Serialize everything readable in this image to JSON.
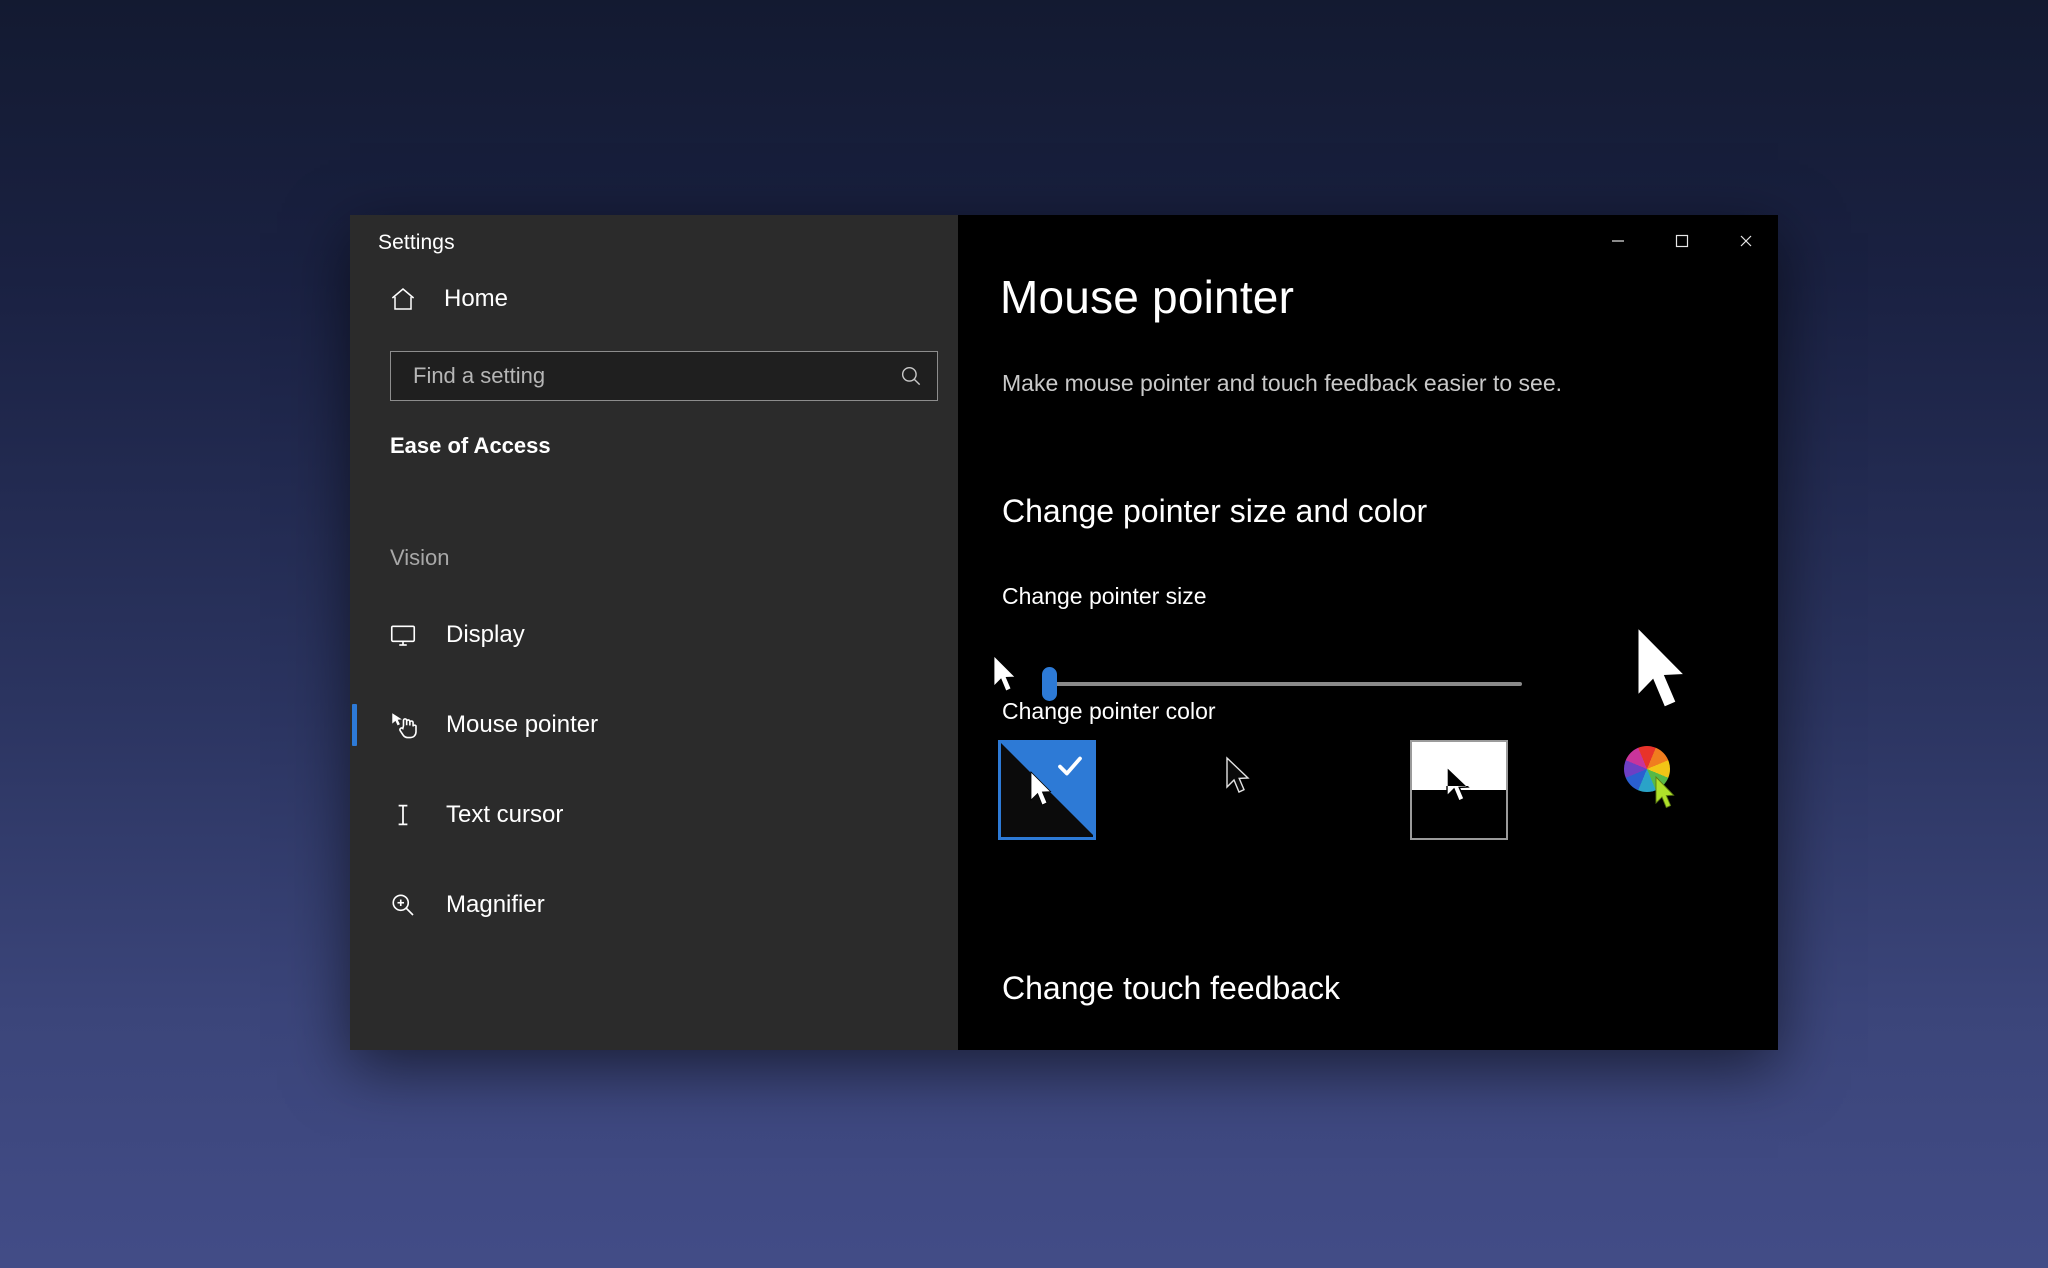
{
  "window": {
    "app_title": "Settings",
    "controls": {
      "minimize_label": "Minimize",
      "maximize_label": "Maximize",
      "close_label": "Close"
    }
  },
  "sidebar": {
    "home_label": "Home",
    "search": {
      "placeholder": "Find a setting",
      "value": "",
      "icon": "search-icon"
    },
    "category_label": "Ease of Access",
    "group_label": "Vision",
    "items": [
      {
        "label": "Display",
        "icon": "monitor-icon",
        "selected": false
      },
      {
        "label": "Mouse pointer",
        "icon": "hand-pointer-icon",
        "selected": true
      },
      {
        "label": "Text cursor",
        "icon": "text-cursor-icon",
        "selected": false
      },
      {
        "label": "Magnifier",
        "icon": "magnifier-icon",
        "selected": false
      }
    ]
  },
  "main": {
    "title": "Mouse pointer",
    "subtitle": "Make mouse pointer and touch feedback easier to see.",
    "section_size_color": "Change pointer size and color",
    "pointer_size": {
      "label": "Change pointer size",
      "value": 1,
      "min": 1,
      "max": 15,
      "small_preview_icon": "small-pointer-icon",
      "large_preview_icon": "large-pointer-icon"
    },
    "pointer_color": {
      "label": "Change pointer color",
      "selected_index": 0,
      "options": [
        {
          "name": "white-pointer",
          "selected": true
        },
        {
          "name": "black-pointer",
          "selected": false
        },
        {
          "name": "inverted-pointer",
          "selected": false
        },
        {
          "name": "custom-color-pointer",
          "selected": false
        }
      ]
    },
    "section_touch_feedback": "Change touch feedback"
  },
  "colors": {
    "accent": "#2d7ad6",
    "sidebar_bg": "#2b2b2b",
    "content_bg": "#000000",
    "text_primary": "#ffffff",
    "text_secondary": "#c9c9c9",
    "desktop_top": "#131a31",
    "desktop_bottom": "#424c87"
  }
}
